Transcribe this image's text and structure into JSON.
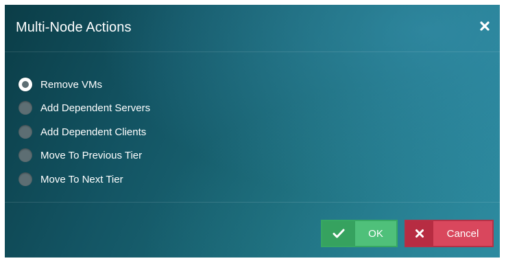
{
  "dialog": {
    "title": "Multi-Node Actions",
    "close_icon": "close-icon"
  },
  "options": [
    {
      "label": "Remove VMs",
      "checked": true
    },
    {
      "label": "Add Dependent Servers",
      "checked": false
    },
    {
      "label": "Add Dependent Clients",
      "checked": false
    },
    {
      "label": "Move To Previous Tier",
      "checked": false
    },
    {
      "label": "Move To Next Tier",
      "checked": false
    }
  ],
  "footer": {
    "ok_label": "OK",
    "ok_icon": "checkmark-icon",
    "cancel_label": "Cancel",
    "cancel_icon": "close-icon"
  },
  "colors": {
    "ok": "#4fc07a",
    "cancel": "#d9475d",
    "dialog_bg": "#135463"
  }
}
